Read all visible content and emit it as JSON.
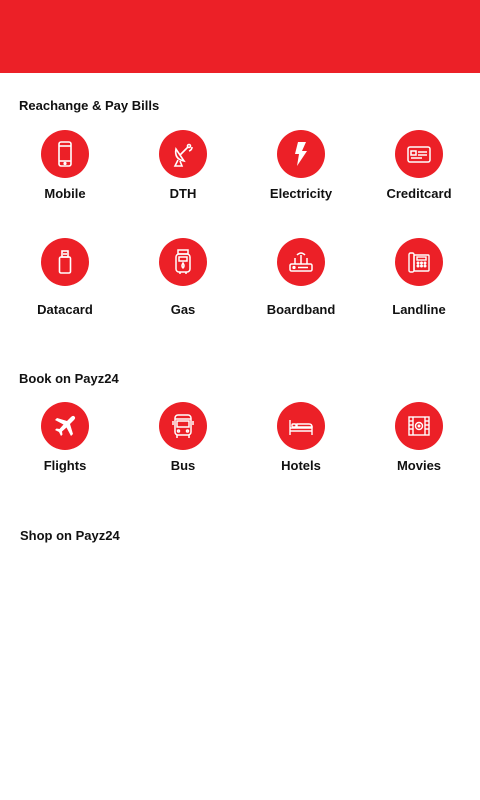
{
  "header": {
    "color": "#ec2027"
  },
  "sections": {
    "recharge": {
      "title": "Reachange & Pay Bills",
      "items": [
        {
          "label": "Mobile",
          "icon": "mobile-icon"
        },
        {
          "label": "DTH",
          "icon": "satellite-dish-icon"
        },
        {
          "label": "Electricity",
          "icon": "lightning-icon"
        },
        {
          "label": "Creditcard",
          "icon": "credit-card-icon"
        },
        {
          "label": "Datacard",
          "icon": "usb-datacard-icon"
        },
        {
          "label": "Gas",
          "icon": "gas-meter-icon"
        },
        {
          "label": "Boardband",
          "icon": "router-icon"
        },
        {
          "label": "Landline",
          "icon": "telephone-icon"
        }
      ]
    },
    "book": {
      "title": "Book on Payz24",
      "items": [
        {
          "label": "Flights",
          "icon": "airplane-icon"
        },
        {
          "label": "Bus",
          "icon": "bus-icon"
        },
        {
          "label": "Hotels",
          "icon": "bed-icon"
        },
        {
          "label": "Movies",
          "icon": "film-icon"
        }
      ]
    },
    "shop": {
      "title": "Shop on Payz24"
    }
  }
}
